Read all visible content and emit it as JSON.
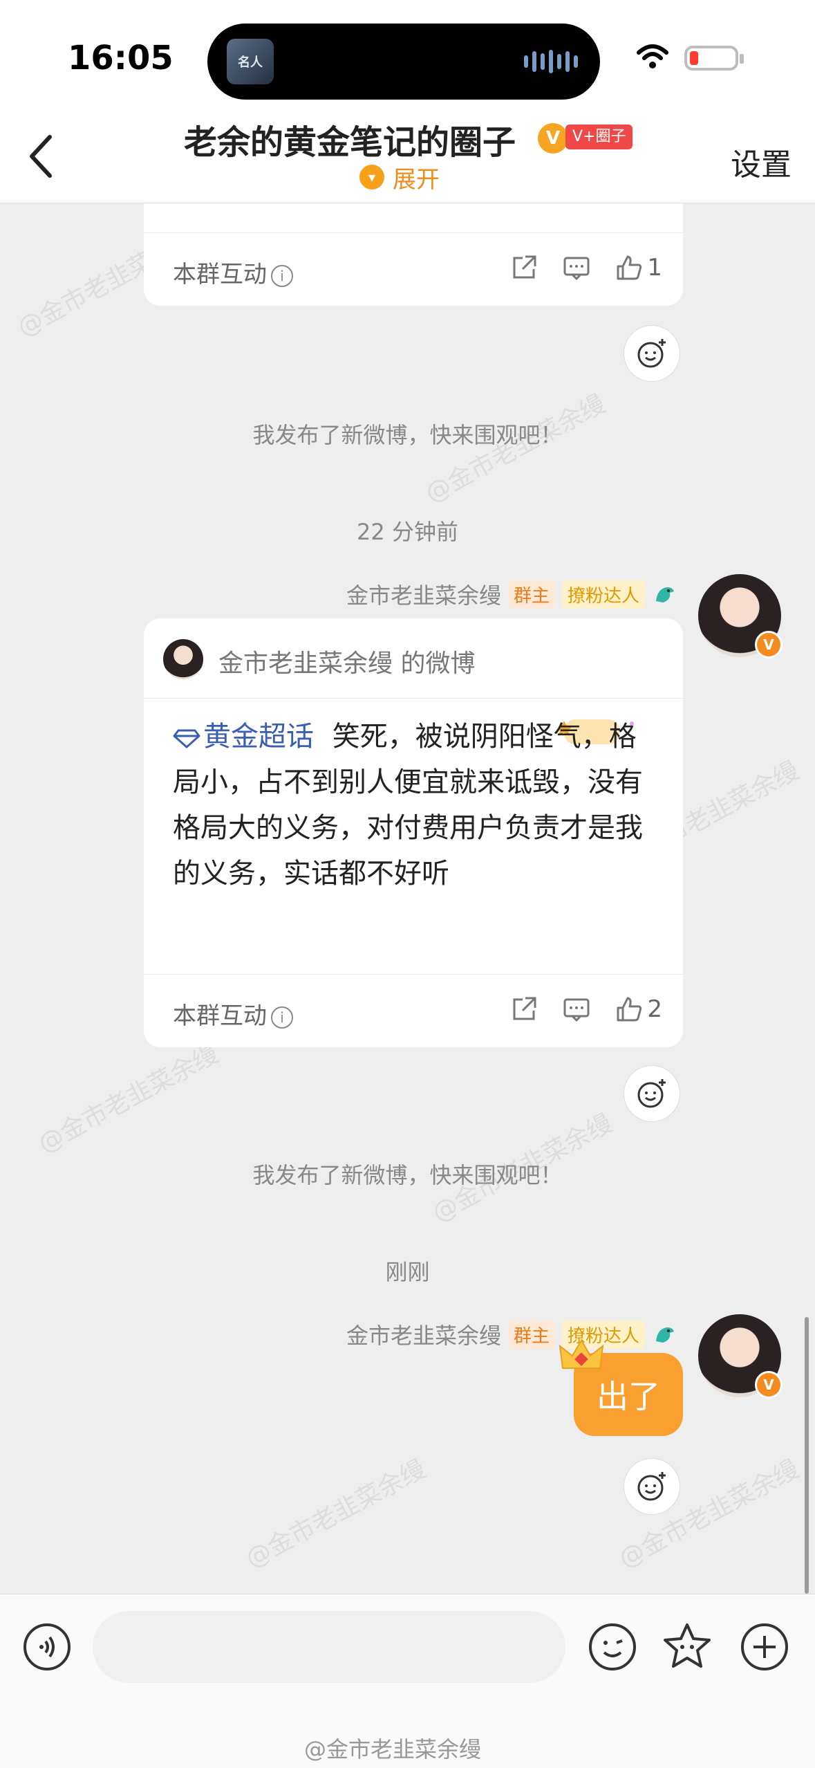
{
  "status_bar": {
    "time": "16:05",
    "island_thumb": "名人",
    "battery_level": 0.12
  },
  "header": {
    "title": "老余的黄金笔记的圈子",
    "badge_v": "V",
    "vplus_label": "V+圈子",
    "expand_label": "展开",
    "settings_label": "设置"
  },
  "card1": {
    "footer_label": "本群互动",
    "like_count": "1"
  },
  "messages": {
    "sys1": "我发布了新微博，快来围观吧！",
    "time1": "22 分钟前",
    "sys2": "我发布了新微博，快来围观吧！",
    "time2": "刚刚"
  },
  "sender": {
    "name": "金市老韭菜余缦",
    "tag_owner": "群主",
    "tag_fan": "撩粉达人"
  },
  "card2": {
    "head_text": "金市老韭菜余缦 的微博",
    "topic": "黄金超话",
    "body": "笑死，被说阴阳怪气，格局小，占不到别人便宜就来诋毁，没有格局大的义务，对付费用户负责才是我的义务，实话都不好听",
    "footer_label": "本群互动",
    "like_count": "2"
  },
  "bubble": {
    "text": "出了"
  },
  "watermark": "@金市老韭菜余缦",
  "footer_watermark": "@金市老韭菜余缦",
  "colors": {
    "accent": "#f9a030",
    "topic": "#3b5fb0",
    "owner_tag": "#f07a1a"
  }
}
